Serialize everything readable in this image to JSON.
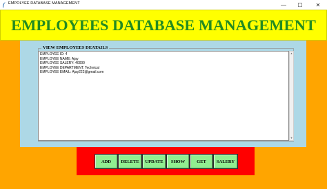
{
  "window": {
    "title": "EMPOLYEE DATABASE MANAGEMENT",
    "controls": {
      "minimize": "—",
      "maximize": "☐",
      "close": "✕"
    }
  },
  "header": {
    "title": "EMPLOYEES DATABASE MANAGEMENT"
  },
  "view_frame": {
    "label": "VIEW EMPLOYEES DEATAILS",
    "lines": [
      "EMPLOYEE ID: 4",
      "EMPLOYEE NAME: Ajay",
      "EMPLOYEE SALERY: 40000",
      "EMPLOYEE DEPARTMENT: Technical",
      "EMPLOYEE EMAIL: Ajay222@gmail.com"
    ]
  },
  "buttons": {
    "add": "ADD",
    "delete": "DELETE",
    "update": "UPDATE",
    "show": "SHOW",
    "get": "GET",
    "salery": "SALERY"
  },
  "colors": {
    "background": "#ffa500",
    "header_bg": "#ffff00",
    "header_text": "#228b22",
    "panel_bg": "#add8e6",
    "button_bar_bg": "#ff0000",
    "button_bg": "#90ee90"
  },
  "icons": {
    "app": "feather-icon",
    "scroll_up": "chevron-up-icon",
    "scroll_down": "chevron-down-icon"
  }
}
